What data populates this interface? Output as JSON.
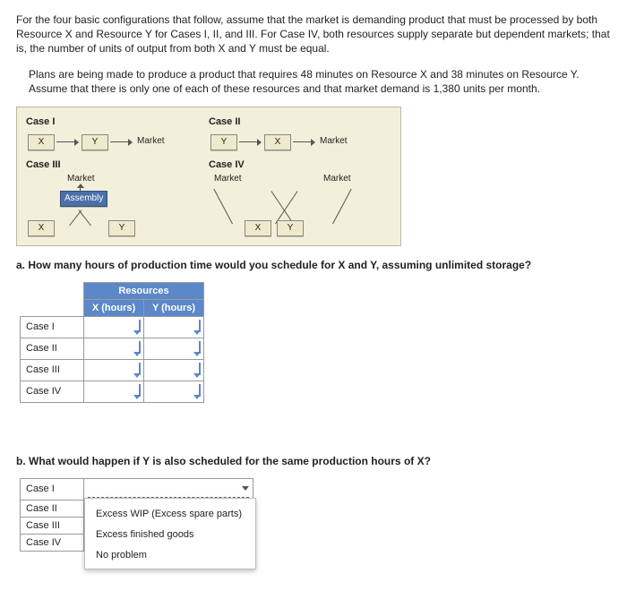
{
  "intro": {
    "p1": "For the four basic configurations that follow, assume that the market is demanding product that must be processed by both Resource X and Resource Y for Cases I, II, and III. For Case IV, both resources supply separate but dependent markets; that is, the number of units of output from both X and Y must be equal.",
    "p2": "Plans are being made to produce a product that requires 48 minutes on Resource X and 38 minutes on Resource Y. Assume that there is only one of each of these resources and that market demand is 1,380 units per month."
  },
  "diagram": {
    "case1": {
      "title": "Case I",
      "boxX": "X",
      "boxY": "Y",
      "market": "Market"
    },
    "case2": {
      "title": "Case II",
      "boxY": "Y",
      "boxX": "X",
      "market": "Market"
    },
    "case3": {
      "title": "Case III",
      "market": "Market",
      "assembly": "Assembly",
      "boxX": "X",
      "boxY": "Y"
    },
    "case4": {
      "title": "Case IV",
      "marketL": "Market",
      "marketR": "Market",
      "boxX": "X",
      "boxY": "Y"
    }
  },
  "qa": {
    "prompt": "a. How many hours of production time would you schedule for X and Y, assuming unlimited storage?",
    "headers": {
      "group": "Resources",
      "x": "X (hours)",
      "y": "Y (hours)"
    },
    "rows": [
      "Case I",
      "Case II",
      "Case III",
      "Case IV"
    ]
  },
  "qb": {
    "prompt": "b. What would happen if Y is also scheduled for the same production hours of X?",
    "rows": [
      "Case I",
      "Case II",
      "Case III",
      "Case IV"
    ],
    "options": [
      "Excess WIP (Excess spare parts)",
      "Excess finished goods",
      "No problem"
    ]
  }
}
